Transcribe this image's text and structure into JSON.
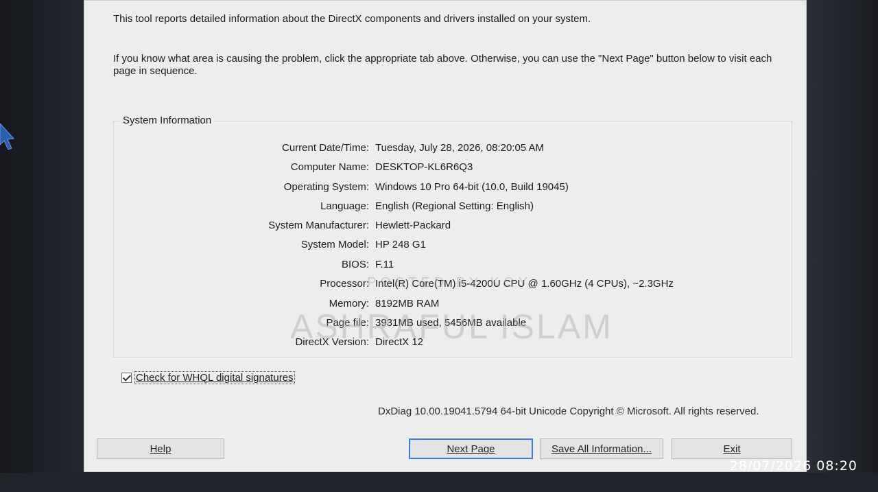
{
  "intro": "This tool reports detailed information about the DirectX components and drivers installed on your system.",
  "hint": "If you know what area is causing the problem, click the appropriate tab above.  Otherwise, you can use the \"Next Page\" button below to visit each page in sequence.",
  "group_title": "System Information",
  "info": [
    {
      "label": "Current Date/Time:",
      "value": "Tuesday, July 28, 2026, 08:20:05 AM"
    },
    {
      "label": "Computer Name:",
      "value": "DESKTOP-KL6R6Q3"
    },
    {
      "label": "Operating System:",
      "value": "Windows 10 Pro 64-bit (10.0, Build 19045)"
    },
    {
      "label": "Language:",
      "value": "English (Regional Setting: English)"
    },
    {
      "label": "System Manufacturer:",
      "value": "Hewlett-Packard"
    },
    {
      "label": "System Model:",
      "value": "HP 248 G1"
    },
    {
      "label": "BIOS:",
      "value": "F.11"
    },
    {
      "label": "Processor:",
      "value": "Intel(R) Core(TM) i5-4200U CPU @ 1.60GHz (4 CPUs), ~2.3GHz"
    },
    {
      "label": "Memory:",
      "value": "8192MB RAM"
    },
    {
      "label": "Page file:",
      "value": "3931MB used, 5456MB available"
    },
    {
      "label": "DirectX Version:",
      "value": "DirectX 12"
    }
  ],
  "whql": {
    "label": "Check for WHQL digital signatures",
    "checked": true
  },
  "copyright": "DxDiag 10.00.19041.5794 64-bit Unicode  Copyright © Microsoft. All rights reserved.",
  "buttons": {
    "help": "Help",
    "next": "Next Page",
    "save": "Save All Information...",
    "exit": "Exit"
  },
  "watermark_small": "POSTED BY KOY",
  "watermark_big": "ASHRAFUL ISLAM",
  "timestamp": "28/07/2026 08:20"
}
